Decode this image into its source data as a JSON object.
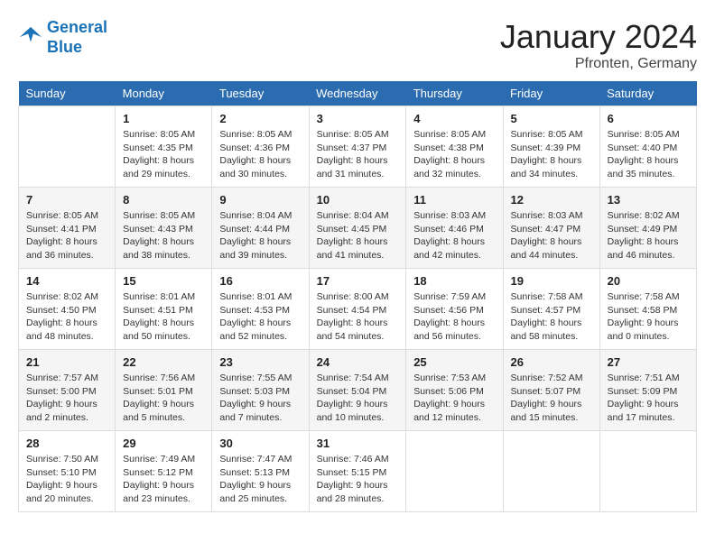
{
  "header": {
    "logo_line1": "General",
    "logo_line2": "Blue",
    "month_title": "January 2024",
    "location": "Pfronten, Germany"
  },
  "days_of_week": [
    "Sunday",
    "Monday",
    "Tuesday",
    "Wednesday",
    "Thursday",
    "Friday",
    "Saturday"
  ],
  "weeks": [
    [
      {
        "day": "",
        "info": ""
      },
      {
        "day": "1",
        "info": "Sunrise: 8:05 AM\nSunset: 4:35 PM\nDaylight: 8 hours\nand 29 minutes."
      },
      {
        "day": "2",
        "info": "Sunrise: 8:05 AM\nSunset: 4:36 PM\nDaylight: 8 hours\nand 30 minutes."
      },
      {
        "day": "3",
        "info": "Sunrise: 8:05 AM\nSunset: 4:37 PM\nDaylight: 8 hours\nand 31 minutes."
      },
      {
        "day": "4",
        "info": "Sunrise: 8:05 AM\nSunset: 4:38 PM\nDaylight: 8 hours\nand 32 minutes."
      },
      {
        "day": "5",
        "info": "Sunrise: 8:05 AM\nSunset: 4:39 PM\nDaylight: 8 hours\nand 34 minutes."
      },
      {
        "day": "6",
        "info": "Sunrise: 8:05 AM\nSunset: 4:40 PM\nDaylight: 8 hours\nand 35 minutes."
      }
    ],
    [
      {
        "day": "7",
        "info": "Sunrise: 8:05 AM\nSunset: 4:41 PM\nDaylight: 8 hours\nand 36 minutes."
      },
      {
        "day": "8",
        "info": "Sunrise: 8:05 AM\nSunset: 4:43 PM\nDaylight: 8 hours\nand 38 minutes."
      },
      {
        "day": "9",
        "info": "Sunrise: 8:04 AM\nSunset: 4:44 PM\nDaylight: 8 hours\nand 39 minutes."
      },
      {
        "day": "10",
        "info": "Sunrise: 8:04 AM\nSunset: 4:45 PM\nDaylight: 8 hours\nand 41 minutes."
      },
      {
        "day": "11",
        "info": "Sunrise: 8:03 AM\nSunset: 4:46 PM\nDaylight: 8 hours\nand 42 minutes."
      },
      {
        "day": "12",
        "info": "Sunrise: 8:03 AM\nSunset: 4:47 PM\nDaylight: 8 hours\nand 44 minutes."
      },
      {
        "day": "13",
        "info": "Sunrise: 8:02 AM\nSunset: 4:49 PM\nDaylight: 8 hours\nand 46 minutes."
      }
    ],
    [
      {
        "day": "14",
        "info": "Sunrise: 8:02 AM\nSunset: 4:50 PM\nDaylight: 8 hours\nand 48 minutes."
      },
      {
        "day": "15",
        "info": "Sunrise: 8:01 AM\nSunset: 4:51 PM\nDaylight: 8 hours\nand 50 minutes."
      },
      {
        "day": "16",
        "info": "Sunrise: 8:01 AM\nSunset: 4:53 PM\nDaylight: 8 hours\nand 52 minutes."
      },
      {
        "day": "17",
        "info": "Sunrise: 8:00 AM\nSunset: 4:54 PM\nDaylight: 8 hours\nand 54 minutes."
      },
      {
        "day": "18",
        "info": "Sunrise: 7:59 AM\nSunset: 4:56 PM\nDaylight: 8 hours\nand 56 minutes."
      },
      {
        "day": "19",
        "info": "Sunrise: 7:58 AM\nSunset: 4:57 PM\nDaylight: 8 hours\nand 58 minutes."
      },
      {
        "day": "20",
        "info": "Sunrise: 7:58 AM\nSunset: 4:58 PM\nDaylight: 9 hours\nand 0 minutes."
      }
    ],
    [
      {
        "day": "21",
        "info": "Sunrise: 7:57 AM\nSunset: 5:00 PM\nDaylight: 9 hours\nand 2 minutes."
      },
      {
        "day": "22",
        "info": "Sunrise: 7:56 AM\nSunset: 5:01 PM\nDaylight: 9 hours\nand 5 minutes."
      },
      {
        "day": "23",
        "info": "Sunrise: 7:55 AM\nSunset: 5:03 PM\nDaylight: 9 hours\nand 7 minutes."
      },
      {
        "day": "24",
        "info": "Sunrise: 7:54 AM\nSunset: 5:04 PM\nDaylight: 9 hours\nand 10 minutes."
      },
      {
        "day": "25",
        "info": "Sunrise: 7:53 AM\nSunset: 5:06 PM\nDaylight: 9 hours\nand 12 minutes."
      },
      {
        "day": "26",
        "info": "Sunrise: 7:52 AM\nSunset: 5:07 PM\nDaylight: 9 hours\nand 15 minutes."
      },
      {
        "day": "27",
        "info": "Sunrise: 7:51 AM\nSunset: 5:09 PM\nDaylight: 9 hours\nand 17 minutes."
      }
    ],
    [
      {
        "day": "28",
        "info": "Sunrise: 7:50 AM\nSunset: 5:10 PM\nDaylight: 9 hours\nand 20 minutes."
      },
      {
        "day": "29",
        "info": "Sunrise: 7:49 AM\nSunset: 5:12 PM\nDaylight: 9 hours\nand 23 minutes."
      },
      {
        "day": "30",
        "info": "Sunrise: 7:47 AM\nSunset: 5:13 PM\nDaylight: 9 hours\nand 25 minutes."
      },
      {
        "day": "31",
        "info": "Sunrise: 7:46 AM\nSunset: 5:15 PM\nDaylight: 9 hours\nand 28 minutes."
      },
      {
        "day": "",
        "info": ""
      },
      {
        "day": "",
        "info": ""
      },
      {
        "day": "",
        "info": ""
      }
    ]
  ]
}
